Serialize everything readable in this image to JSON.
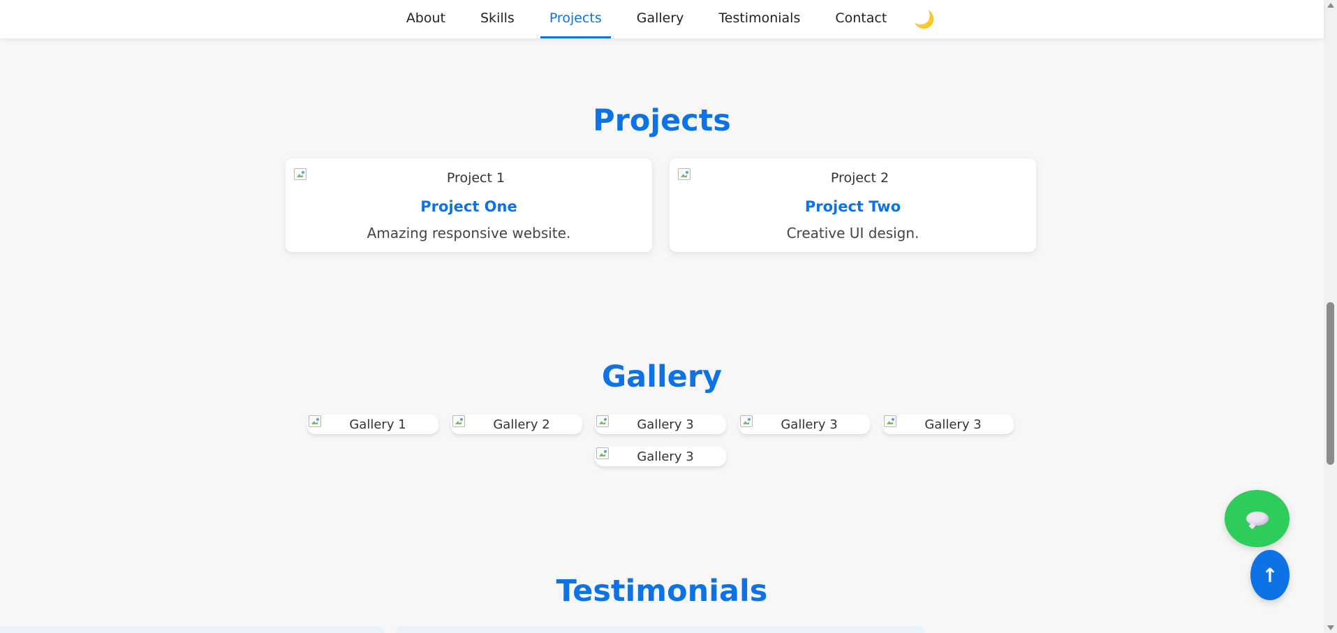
{
  "nav": {
    "links": [
      {
        "label": "About"
      },
      {
        "label": "Skills"
      },
      {
        "label": "Projects",
        "active": true
      },
      {
        "label": "Gallery"
      },
      {
        "label": "Testimonials"
      },
      {
        "label": "Contact"
      }
    ],
    "theme_toggle_icon": "🌙",
    "accent_color": "#0d72e6"
  },
  "projects": {
    "title": "Projects",
    "cards": [
      {
        "image_alt": "Project 1",
        "name": "Project One",
        "description": "Amazing responsive website."
      },
      {
        "image_alt": "Project 2",
        "name": "Project Two",
        "description": "Creative UI design."
      }
    ]
  },
  "gallery": {
    "title": "Gallery",
    "items": [
      {
        "image_alt": "Gallery 1"
      },
      {
        "image_alt": "Gallery 2"
      },
      {
        "image_alt": "Gallery 3"
      },
      {
        "image_alt": "Gallery 3"
      },
      {
        "image_alt": "Gallery 3"
      },
      {
        "image_alt": "Gallery 3"
      }
    ]
  },
  "testimonials": {
    "title": "Testimonials"
  },
  "floating": {
    "chat_icon": "chat-bubble-icon",
    "chat_color": "#2ecc5a",
    "back_to_top_icon": "arrow-up-icon",
    "back_to_top_glyph": "↑"
  }
}
